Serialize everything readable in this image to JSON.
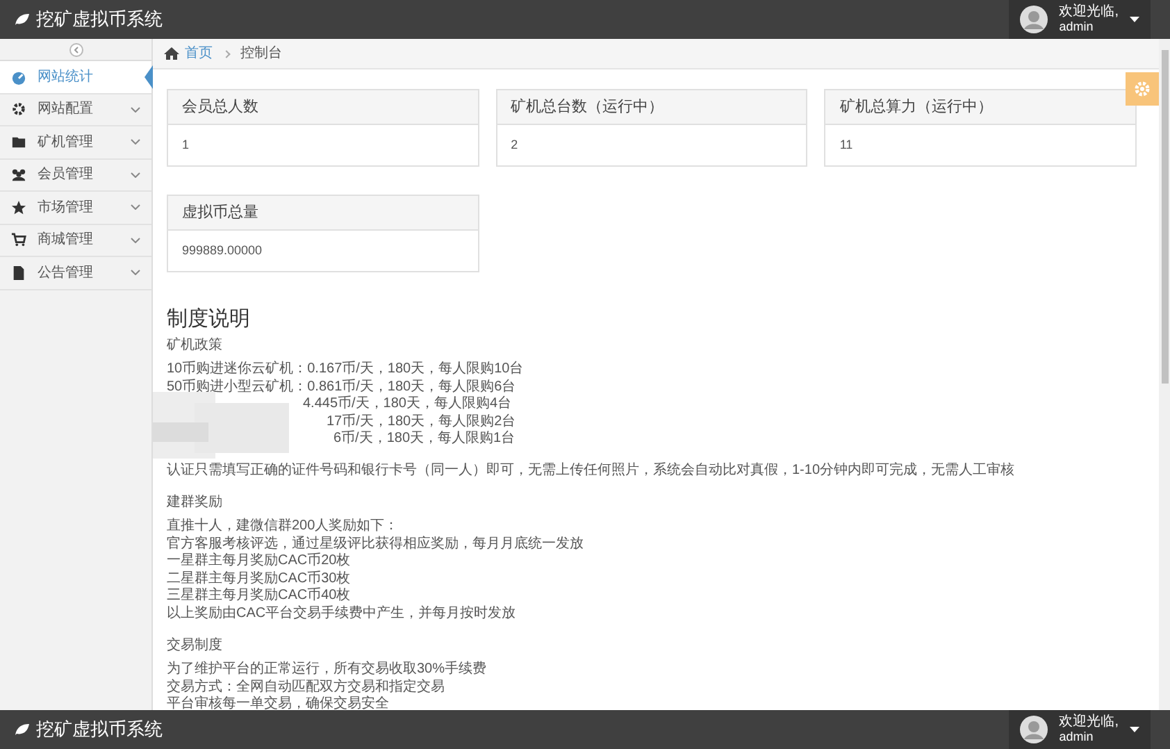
{
  "header": {
    "logo": "挖矿虚拟币系统",
    "user_greeting": "欢迎光临,",
    "user_name": "admin"
  },
  "sidebar": {
    "items": [
      {
        "label": "网站统计",
        "selected": true,
        "kind": "gauge",
        "expandable": false
      },
      {
        "label": "网站配置",
        "selected": false,
        "kind": "gear",
        "expandable": true
      },
      {
        "label": "矿机管理",
        "selected": false,
        "kind": "folder",
        "expandable": true
      },
      {
        "label": "会员管理",
        "selected": false,
        "kind": "users",
        "expandable": true
      },
      {
        "label": "市场管理",
        "selected": false,
        "kind": "star",
        "expandable": true
      },
      {
        "label": "商城管理",
        "selected": false,
        "kind": "cart",
        "expandable": true
      },
      {
        "label": "公告管理",
        "selected": false,
        "kind": "file",
        "expandable": true
      }
    ]
  },
  "breadcrumb": [
    "首页",
    "控制台"
  ],
  "stat_cards": [
    {
      "title": "会员总人数",
      "value": "1"
    },
    {
      "title": "矿机总台数（运行中）",
      "value": "2"
    },
    {
      "title": "矿机总算力（运行中）",
      "value": "11"
    },
    {
      "title": "虚拟币总量",
      "value": "999889.00000"
    }
  ],
  "rules": {
    "title": "制度说明",
    "sections": [
      {
        "heading": "矿机政策",
        "lines": [
          "10币购进迷你云矿机：0.167币/天，180天，每人限购10台",
          "50币购进小型云矿机：0.861币/天，180天，每人限购6台",
          "4.445币/天，180天，每人限购4台",
          "17币/天，180天，每人限购2台",
          "6币/天，180天，每人限购1台"
        ]
      },
      {
        "lines": [
          "认证只需填写正确的证件号码和银行卡号（同一人）即可，无需上传任何照片，系统会自动比对真假，1-10分钟内即可完成，无需人工审核"
        ]
      },
      {
        "heading": "建群奖励",
        "lines": [
          "直推十人，建微信群200人奖励如下：",
          "官方客服考核评选，通过星级评比获得相应奖励，每月月底统一发放",
          "一星群主每月奖励CAC币20枚",
          "二星群主每月奖励CAC币30枚",
          "三星群主每月奖励CAC币40枚",
          "以上奖励由CAC平台交易手续费中产生，并每月按时发放"
        ]
      },
      {
        "heading": "交易制度",
        "lines": [
          "为了维护平台的正常运行，所有交易收取30%手续费",
          "交易方式：全网自动匹配双方交易和指定交易",
          "平台审核每一单交易，确保交易安全"
        ]
      }
    ]
  },
  "footer_bar": {
    "logo": "挖矿虚拟币系统",
    "user_greeting": "欢迎光临,",
    "user_name": "admin"
  }
}
